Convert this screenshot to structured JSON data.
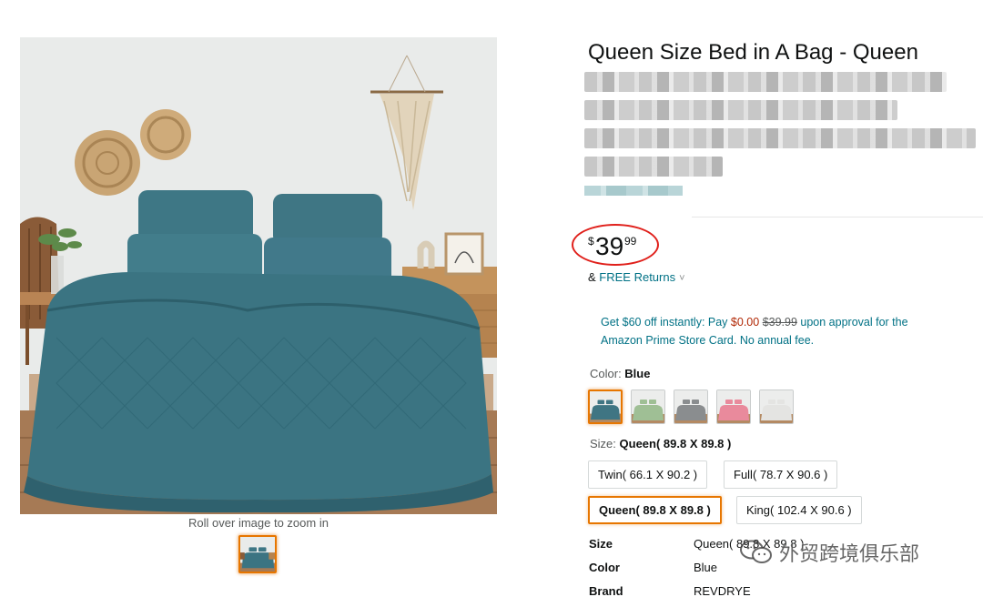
{
  "product": {
    "title": "Queen Size Bed in A Bag - Queen",
    "zoom_hint": "Roll over image to zoom in",
    "main_image": "teal-bedding-photo",
    "colors": {
      "accent": "#e77600",
      "link": "#007185",
      "sale": "#b12704",
      "annotation": "#e0201b"
    }
  },
  "price": {
    "symbol": "$",
    "whole": "39",
    "fraction": "99"
  },
  "returns": {
    "prefix": "& ",
    "link": "FREE Returns",
    "chevron": "˅"
  },
  "promo": {
    "line1_prefix": "Get $60 off instantly: Pay ",
    "pay": "$0.00",
    "was": "$39.99",
    "line1_suffix": " upon approval for the",
    "line2": "Amazon Prime Store Card. No annual fee."
  },
  "color": {
    "label": "Color: ",
    "selected": "Blue",
    "swatches": [
      {
        "name": "Blue",
        "hex": "#3f7583"
      },
      {
        "name": "Green",
        "hex": "#9fbf95"
      },
      {
        "name": "Grey",
        "hex": "#8a8d8f"
      },
      {
        "name": "Pink",
        "hex": "#e98a9c"
      },
      {
        "name": "White",
        "hex": "#e4e4e2"
      }
    ]
  },
  "size": {
    "label": "Size: ",
    "selected": "Queen( 89.8 X 89.8 )",
    "options": [
      "Twin( 66.1 X 90.2 )",
      "Full( 78.7 X 90.6 )",
      "Queen( 89.8 X 89.8 )",
      "King( 102.4 X 90.6 )"
    ]
  },
  "specs": [
    {
      "key": "Size",
      "value": "Queen( 89.8 X 89.8 )"
    },
    {
      "key": "Color",
      "value": "Blue"
    },
    {
      "key": "Brand",
      "value": "REVDRYE"
    }
  ],
  "watermark": {
    "text": "外贸跨境俱乐部",
    "icon": "wechat-icon"
  }
}
